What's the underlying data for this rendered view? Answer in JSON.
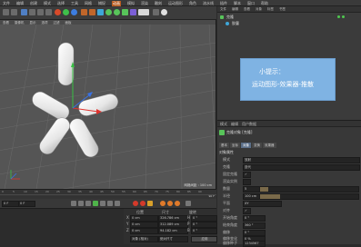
{
  "menu": {
    "items": [
      "文件",
      "编辑",
      "创建",
      "模式",
      "选择",
      "工具",
      "网格",
      "捕捉",
      "动画",
      "模拟",
      "渲染",
      "雕刻",
      "运动图形",
      "角色",
      "流水线",
      "插件",
      "脚本",
      "窗口",
      "帮助"
    ]
  },
  "viewport": {
    "menu": [
      "查看",
      "摄像机",
      "显示",
      "选项",
      "过滤",
      "面板"
    ],
    "grid_label": "网格间距 : 100 cm"
  },
  "timeline": {
    "ticks": [
      "0",
      "5",
      "10",
      "15",
      "20",
      "25",
      "30",
      "35",
      "40",
      "45",
      "50",
      "55",
      "60",
      "65",
      "70",
      "75",
      "80",
      "85",
      "90"
    ],
    "frame_end": "90 F",
    "frame_current": "0 F"
  },
  "coord": {
    "headers": {
      "position": "位置",
      "size": "尺寸",
      "rotation": "旋转"
    },
    "rows": [
      {
        "axis": "X",
        "pos": "0 cm",
        "size": "326.786 cm",
        "rot_axis": "H",
        "rot": "0 °"
      },
      {
        "axis": "Y",
        "pos": "0 cm",
        "size": "312.089 cm",
        "rot_axis": "P",
        "rot": "0 °"
      },
      {
        "axis": "Z",
        "pos": "0 cm",
        "size": "94.182 cm",
        "rot_axis": "B",
        "rot": "0 °"
      }
    ],
    "mode_select": "对象 (相对)",
    "size_select": "绝对尺寸",
    "apply_button": "应用"
  },
  "object_manager": {
    "menu": [
      "文件",
      "编辑",
      "查看",
      "对象",
      "标签",
      "书签"
    ],
    "items": [
      "克隆",
      "胶囊"
    ]
  },
  "tip": {
    "line1": "小提示：",
    "line2": "运动图形-效果器-推散"
  },
  "attributes": {
    "menu": [
      "模式",
      "编辑",
      "用户数据"
    ],
    "object_title": "克隆对象 [克隆]",
    "tabs": [
      "基本",
      "坐标",
      "对象",
      "变换",
      "效果器"
    ],
    "section_title": "对象属性",
    "fields": [
      {
        "label": "模式",
        "value": "放射"
      },
      {
        "label": "克隆",
        "value": "迭代"
      },
      {
        "label": "固定克隆",
        "value": "✓"
      },
      {
        "label": "渲染实例",
        "value": ""
      },
      {
        "label": "数量",
        "value": "5"
      },
      {
        "label": "半径",
        "value": "100 cm"
      },
      {
        "label": "平面",
        "value": "XY"
      },
      {
        "label": "对齐",
        "value": "✓"
      },
      {
        "label": "开始角度",
        "value": "0 °"
      },
      {
        "label": "结束角度",
        "value": "360 °"
      },
      {
        "label": "偏移",
        "value": "0 °"
      },
      {
        "label": "偏移变化",
        "value": "0 %"
      },
      {
        "label": "偏移种子",
        "value": "1234567"
      }
    ]
  },
  "colors": {
    "accent": "#b85a1f",
    "tip_bg": "#7fb3e3",
    "capsule": "#f0f0f0",
    "axis_x": "#e0342f",
    "axis_y": "#38c043",
    "axis_z": "#3872e6"
  },
  "icons": [
    "undo-icon",
    "redo-icon",
    "move-icon",
    "scale-icon",
    "rotate-icon",
    "cube-icon",
    "pen-icon",
    "cloner-icon",
    "deformer-icon",
    "camera-icon",
    "light-icon"
  ]
}
